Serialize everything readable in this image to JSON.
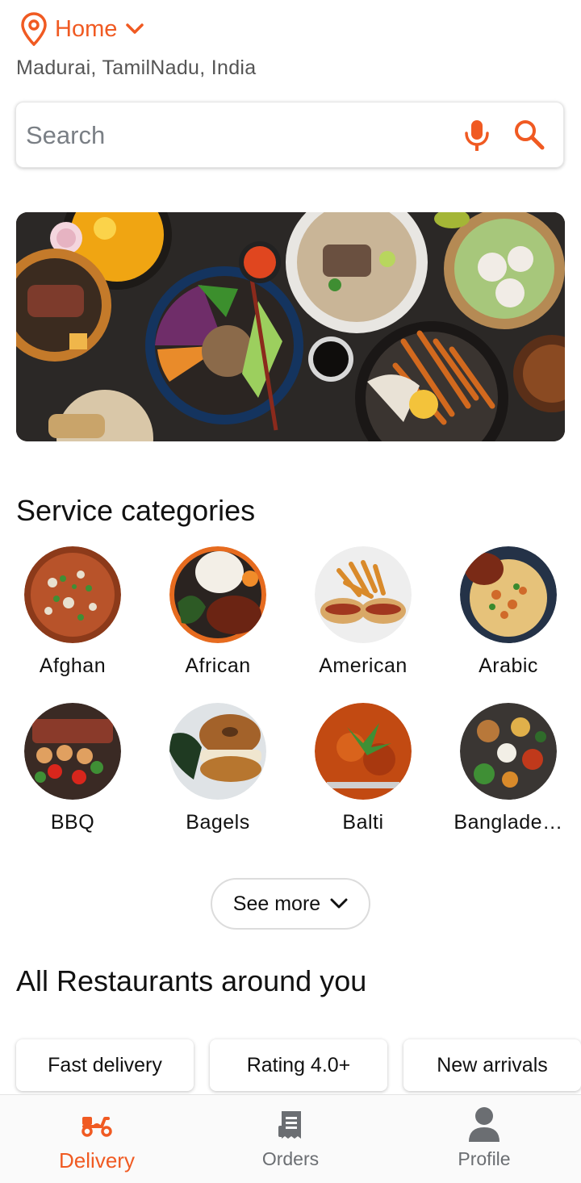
{
  "header": {
    "location_title": "Home",
    "location_subtitle": "Madurai, TamilNadu, India"
  },
  "search": {
    "placeholder": "Search"
  },
  "categories": {
    "title": "Service categories",
    "items": [
      {
        "label": "Afghan"
      },
      {
        "label": "African"
      },
      {
        "label": "American"
      },
      {
        "label": "Arabic"
      },
      {
        "label": "BBQ"
      },
      {
        "label": "Bagels"
      },
      {
        "label": "Balti"
      },
      {
        "label": "Banglade…"
      }
    ],
    "see_more_label": "See more"
  },
  "restaurants": {
    "title": "All Restaurants around you",
    "filters": [
      {
        "label": "Fast delivery"
      },
      {
        "label": "Rating 4.0+"
      },
      {
        "label": "New arrivals"
      }
    ]
  },
  "bottom_nav": {
    "items": [
      {
        "label": "Delivery",
        "icon": "scooter-icon",
        "active": true
      },
      {
        "label": "Orders",
        "icon": "receipt-icon",
        "active": false
      },
      {
        "label": "Profile",
        "icon": "person-icon",
        "active": false
      }
    ]
  },
  "colors": {
    "accent": "#f05a22",
    "inactive": "#6b6e72"
  }
}
